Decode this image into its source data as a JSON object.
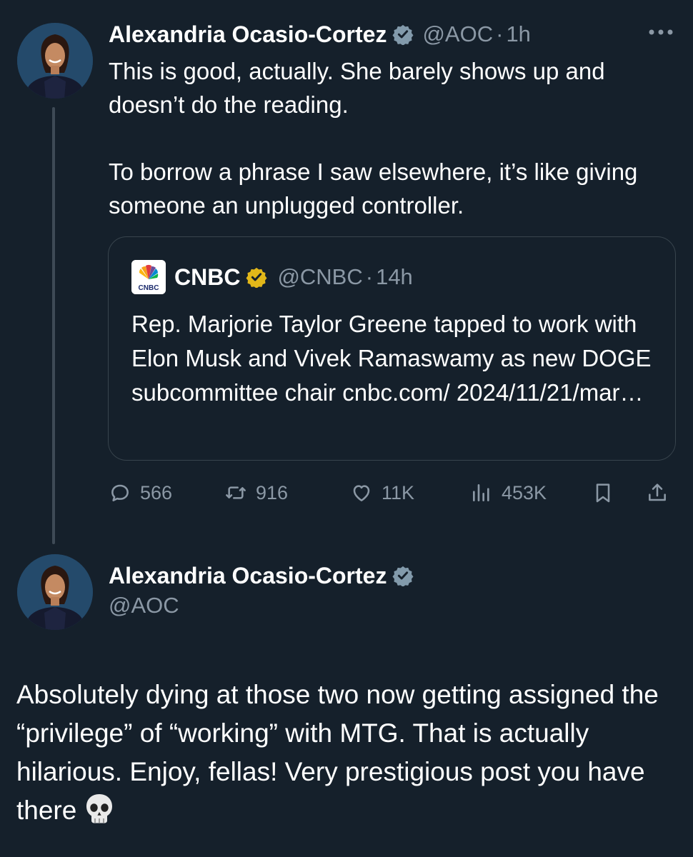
{
  "tweet1": {
    "name": "Alexandria Ocasio-Cortez",
    "handle": "@AOC",
    "dot": "·",
    "time": "1h",
    "paragraph1": "This is good, actually. She barely shows up and doesn’t do the reading.",
    "paragraph2": "To borrow a phrase I saw elsewhere, it’s like giving someone an unplugged controller.",
    "quote": {
      "name": "CNBC",
      "handle": "@CNBC",
      "dot": "·",
      "time": "14h",
      "text": "Rep. Marjorie Taylor Greene tapped to work with Elon Musk and Vivek Ramaswamy as new DOGE subcommittee chair cnbc.com/ 2024/11/21/mar…",
      "logo_text": "CNBC"
    },
    "actions": {
      "replies": "566",
      "retweets": "916",
      "likes": "11K",
      "views": "453K"
    }
  },
  "tweet2": {
    "name": "Alexandria Ocasio-Cortez",
    "handle": "@AOC",
    "text": "Absolutely dying at those two now getting assigned the “privilege” of “working” with MTG. That is actually hilarious. Enjoy, fellas! Very prestigious post you have there"
  },
  "colors": {
    "background": "#15202b",
    "text": "#ffffff",
    "secondary": "#8b98a5",
    "border": "#38444d",
    "verified_blue": "#829aab",
    "verified_gold": "#e2b719"
  }
}
